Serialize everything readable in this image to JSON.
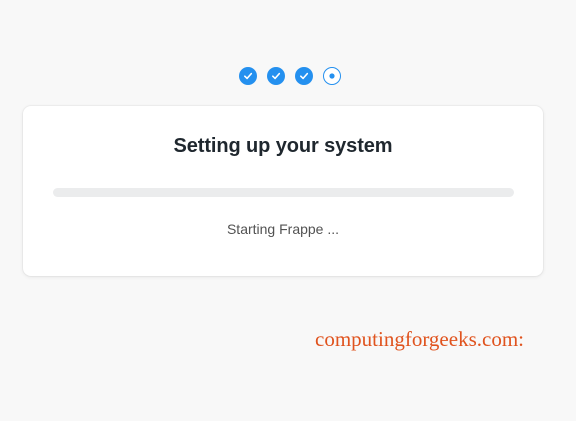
{
  "steps": [
    {
      "state": "done",
      "icon": "check-icon"
    },
    {
      "state": "done",
      "icon": "check-icon"
    },
    {
      "state": "done",
      "icon": "check-icon"
    },
    {
      "state": "active",
      "icon": "dot-icon"
    }
  ],
  "setup": {
    "title": "Setting up your system",
    "progress": 0,
    "status": "Starting Frappe ..."
  },
  "watermark": "computingforgeeks.com:",
  "colors": {
    "accent": "#2490ef",
    "background": "#f8f8f8",
    "card": "#ffffff",
    "track": "#ebeced",
    "title": "#1f272e",
    "status_text": "#525252",
    "watermark": "#e0531e"
  }
}
